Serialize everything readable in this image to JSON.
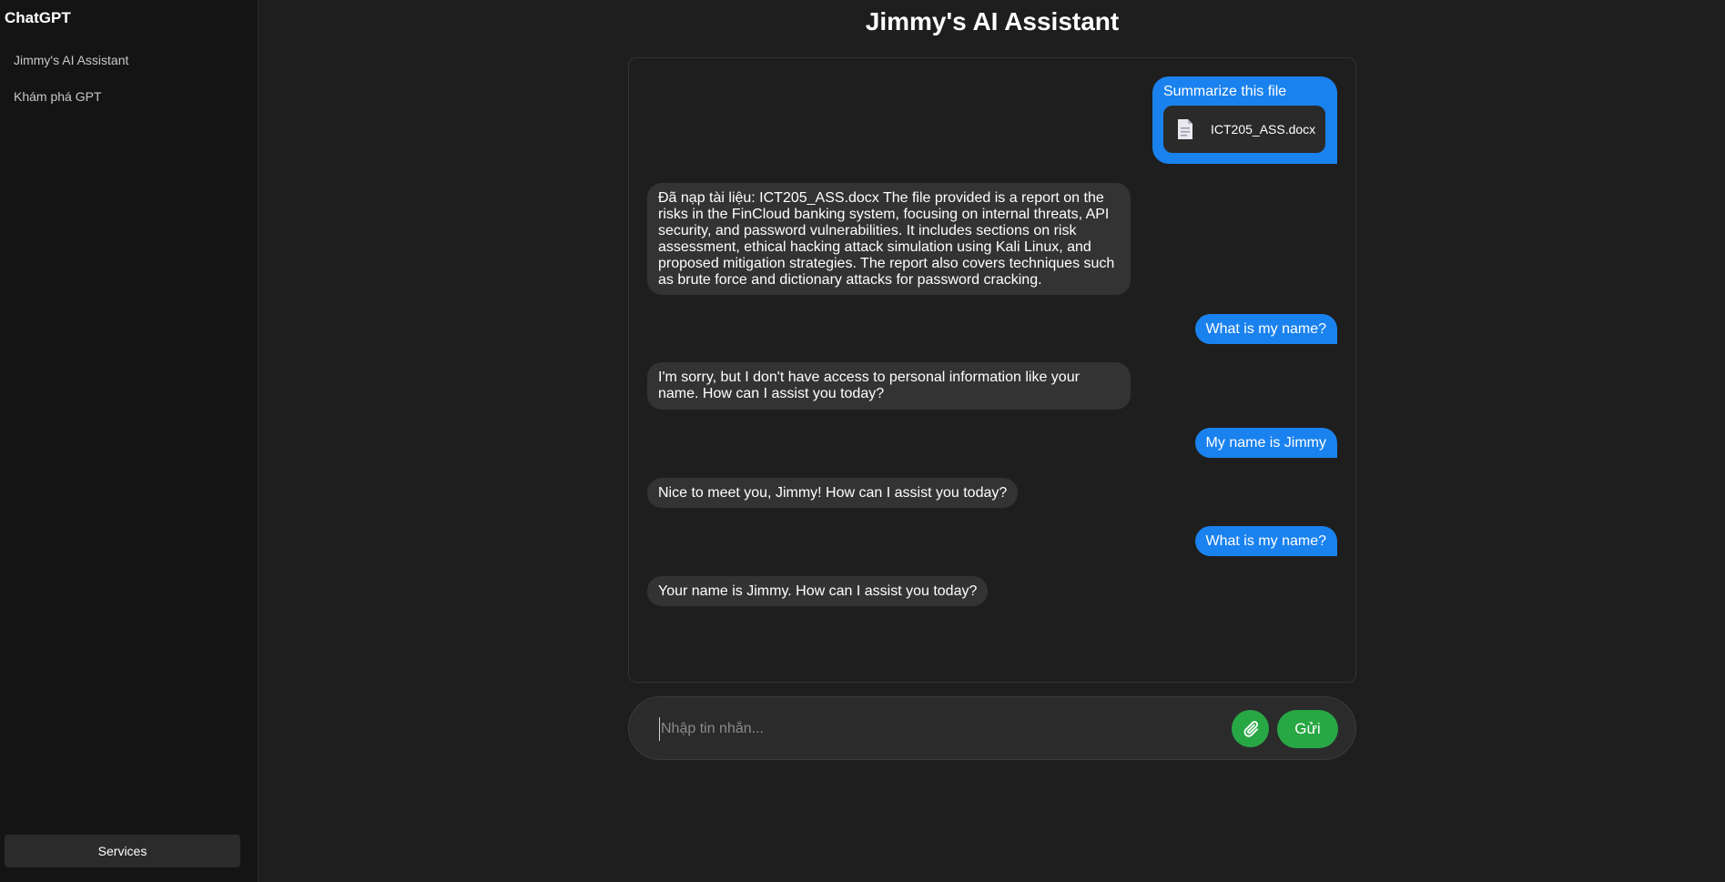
{
  "sidebar": {
    "brand": "ChatGPT",
    "items": [
      {
        "label": "Jimmy's AI Assistant"
      },
      {
        "label": "Khám phá GPT"
      }
    ],
    "services_label": "Services"
  },
  "header": {
    "title": "Jimmy's AI Assistant"
  },
  "messages": [
    {
      "role": "user",
      "text": "Summarize this file",
      "attachment": {
        "name": "ICT205_ASS.docx",
        "icon": "document-icon"
      }
    },
    {
      "role": "assistant",
      "text": "Đã nạp tài liệu: ICT205_ASS.docx The file provided is a report on the risks in the FinCloud banking system, focusing on internal threats, API security, and password vulnerabilities. It includes sections on risk assessment, ethical hacking attack simulation using Kali Linux, and proposed mitigation strategies. The report also covers techniques such as brute force and dictionary attacks for password cracking."
    },
    {
      "role": "user",
      "text": "What is my name?"
    },
    {
      "role": "assistant",
      "text": "I'm sorry, but I don't have access to personal information like your name. How can I assist you today?"
    },
    {
      "role": "user",
      "text": "My name is Jimmy"
    },
    {
      "role": "assistant",
      "text": "Nice to meet you, Jimmy! How can I assist you today?"
    },
    {
      "role": "user",
      "text": "What is my name?"
    },
    {
      "role": "assistant",
      "text": "Your name is Jimmy. How can I assist you today?"
    }
  ],
  "composer": {
    "placeholder": "Nhập tin nhắn...",
    "value": "",
    "attach_icon": "paperclip-icon",
    "send_label": "Gửi"
  },
  "colors": {
    "user_bubble": "#1a82ee",
    "assistant_bubble": "#333333",
    "accent_green": "#28a745",
    "sidebar_bg": "#141414",
    "page_bg": "#1e1e1e"
  }
}
